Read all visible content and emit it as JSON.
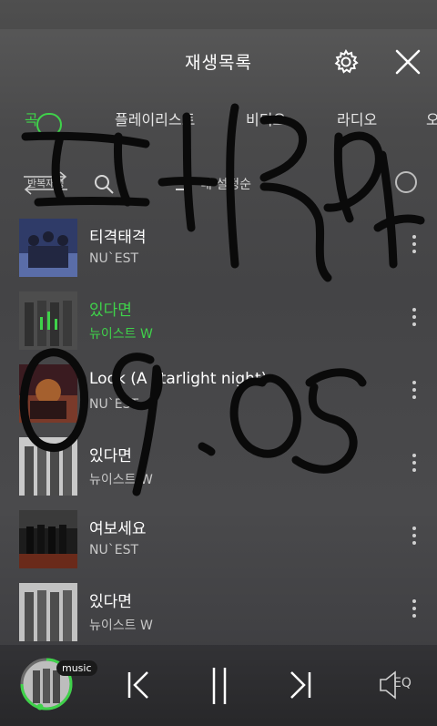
{
  "header": {
    "title": "재생목록",
    "settings_icon": "gear-icon",
    "close_icon": "close-icon"
  },
  "tabs": [
    {
      "label": "곡",
      "active": true
    },
    {
      "label": "플레이리스트",
      "active": false
    },
    {
      "label": "비디오",
      "active": false
    },
    {
      "label": "라디오",
      "active": false
    },
    {
      "label": "오",
      "active": false
    }
  ],
  "toolbar": {
    "repeat_label": "반복재생",
    "search_icon": "search-icon",
    "sort_label": "내 설정순",
    "sort_icon": "sort-icon",
    "select_icon": "select-all-icon"
  },
  "tracks": [
    {
      "title": "티격태격",
      "artist": "NU`EST",
      "playing": false,
      "thumb_bg": "#3b4a7a"
    },
    {
      "title": "있다면",
      "artist": "뉴이스트 W",
      "playing": true,
      "thumb_bg": "#5a5a5a"
    },
    {
      "title": "Look (A starlight night)",
      "artist": "NU`EST",
      "playing": false,
      "thumb_bg": "#6a2a2a"
    },
    {
      "title": "있다면",
      "artist": "뉴이스트 W",
      "playing": false,
      "thumb_bg": "#b9b9b9"
    },
    {
      "title": "여보세요",
      "artist": "NU`EST",
      "playing": false,
      "thumb_bg": "#2a2a2a"
    },
    {
      "title": "있다면",
      "artist": "뉴이스트 W",
      "playing": false,
      "thumb_bg": "#b0b0b0"
    }
  ],
  "player": {
    "badge": "music",
    "prev_icon": "previous-icon",
    "pause_icon": "pause-icon",
    "next_icon": "next-icon",
    "eq_label": "EQ",
    "progress": 0.75
  },
  "colors": {
    "accent": "#3fd24a"
  }
}
